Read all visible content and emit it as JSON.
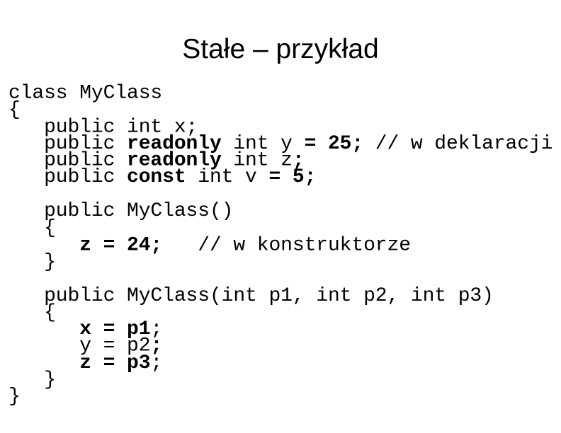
{
  "slide": {
    "title": "Stałe – przykład",
    "code_lines": [
      {
        "segments": [
          {
            "t": "class MyClass",
            "b": false
          }
        ]
      },
      {
        "segments": [
          {
            "t": "{",
            "b": false
          }
        ]
      },
      {
        "segments": [
          {
            "t": "   public int x;",
            "b": false
          }
        ]
      },
      {
        "segments": [
          {
            "t": "   public ",
            "b": false
          },
          {
            "t": "readonly",
            "b": true
          },
          {
            "t": " int y ",
            "b": false
          },
          {
            "t": "= 25;",
            "b": true
          },
          {
            "t": " // w deklaracji",
            "b": false
          }
        ]
      },
      {
        "segments": [
          {
            "t": "   public ",
            "b": false
          },
          {
            "t": "readonly",
            "b": true
          },
          {
            "t": " int z",
            "b": false
          },
          {
            "t": ";",
            "b": true
          }
        ]
      },
      {
        "segments": [
          {
            "t": "   public ",
            "b": false
          },
          {
            "t": "const",
            "b": true
          },
          {
            "t": " int v ",
            "b": false
          },
          {
            "t": "= 5;",
            "b": true
          }
        ]
      },
      {
        "segments": [
          {
            "t": "",
            "b": false
          }
        ]
      },
      {
        "segments": [
          {
            "t": "   public MyClass()",
            "b": false
          }
        ]
      },
      {
        "segments": [
          {
            "t": "   {",
            "b": false
          }
        ]
      },
      {
        "segments": [
          {
            "t": "      ",
            "b": false
          },
          {
            "t": "z = 24;",
            "b": true
          },
          {
            "t": "   // w konstruktorze",
            "b": false
          }
        ]
      },
      {
        "segments": [
          {
            "t": "   }",
            "b": false
          }
        ]
      },
      {
        "segments": [
          {
            "t": "",
            "b": false
          }
        ]
      },
      {
        "segments": [
          {
            "t": "   public MyClass(int p1, int p2, int p3)",
            "b": false
          }
        ]
      },
      {
        "segments": [
          {
            "t": "   {",
            "b": false
          }
        ]
      },
      {
        "segments": [
          {
            "t": "      ",
            "b": false
          },
          {
            "t": "x = p1",
            "b": true
          },
          {
            "t": ";",
            "b": false
          }
        ]
      },
      {
        "segments": [
          {
            "t": "      y = p2",
            "b": false
          },
          {
            "t": ";",
            "b": true
          }
        ]
      },
      {
        "segments": [
          {
            "t": "      ",
            "b": false
          },
          {
            "t": "z = p3",
            "b": true
          },
          {
            "t": ";",
            "b": false
          }
        ]
      },
      {
        "segments": [
          {
            "t": "   }",
            "b": false
          }
        ]
      },
      {
        "segments": [
          {
            "t": "}",
            "b": false
          }
        ]
      }
    ]
  }
}
